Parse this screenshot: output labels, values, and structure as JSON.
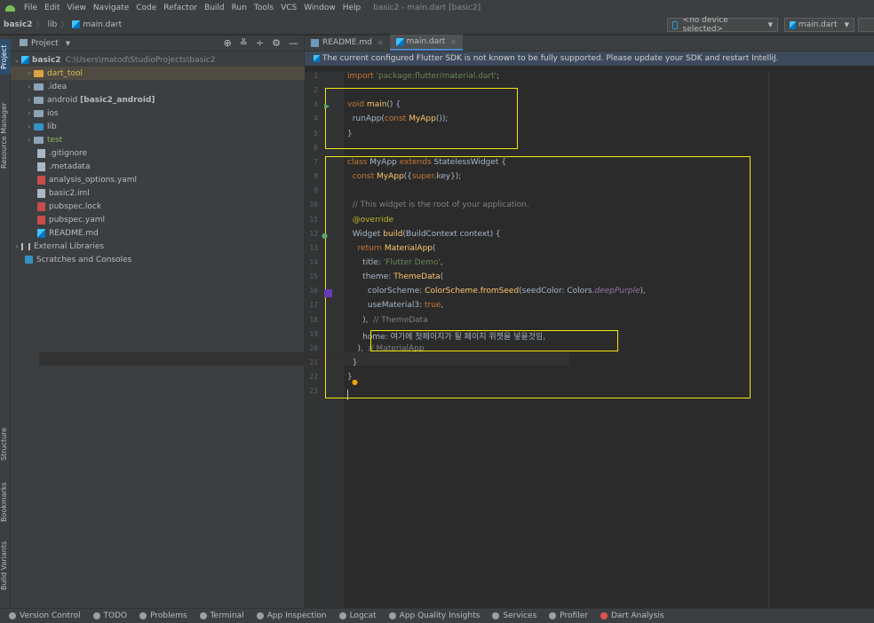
{
  "menu": {
    "items": [
      "File",
      "Edit",
      "View",
      "Navigate",
      "Code",
      "Refactor",
      "Build",
      "Run",
      "Tools",
      "VCS",
      "Window",
      "Help"
    ],
    "window_title": "basic2 - main.dart [basic2]"
  },
  "nav": {
    "crumbs": [
      "basic2",
      "lib",
      "main.dart"
    ],
    "device": "<no device selected>",
    "run_config": "main.dart"
  },
  "side_tabs": {
    "project": "Project",
    "resource_manager": "Resource Manager",
    "structure": "Structure",
    "bookmarks": "Bookmarks",
    "build_variants": "Build Variants"
  },
  "project": {
    "title": "Project",
    "root_name": "basic2",
    "root_path": "C:\\Users\\matod\\StudioProjects\\basic2",
    "items": [
      {
        "label": "dart_tool",
        "kind": "folder-y",
        "depth": 1,
        "expand": true
      },
      {
        "label": ".idea",
        "kind": "folder-g",
        "depth": 1,
        "expand": true
      },
      {
        "label": "android",
        "extra": "[basic2_android]",
        "kind": "folder-g",
        "depth": 1,
        "expand": true
      },
      {
        "label": "ios",
        "kind": "folder-g",
        "depth": 1,
        "expand": true
      },
      {
        "label": "lib",
        "kind": "folder-b",
        "depth": 1,
        "expand": true
      },
      {
        "label": "test",
        "kind": "folder-g",
        "depth": 1,
        "expand": true
      },
      {
        "label": ".gitignore",
        "kind": "file",
        "depth": 1
      },
      {
        "label": ".metadata",
        "kind": "file",
        "depth": 1
      },
      {
        "label": "analysis_options.yaml",
        "kind": "file-yml",
        "depth": 1
      },
      {
        "label": "basic2.iml",
        "kind": "file",
        "depth": 1
      },
      {
        "label": "pubspec.lock",
        "kind": "file-yml",
        "depth": 1
      },
      {
        "label": "pubspec.yaml",
        "kind": "file-yml",
        "depth": 1
      },
      {
        "label": "README.md",
        "kind": "file-md",
        "depth": 1
      },
      {
        "label": "External Libraries",
        "kind": "lib",
        "depth": 0,
        "expand": true
      },
      {
        "label": "Scratches and Consoles",
        "kind": "scratch",
        "depth": 0
      }
    ]
  },
  "tabs": [
    {
      "label": "README.md"
    },
    {
      "label": "main.dart",
      "active": true
    }
  ],
  "banner": "The current configured Flutter SDK is not known to be fully supported. Please update your SDK and restart IntelliJ.",
  "editor": {
    "line_numbers": [
      "1",
      "2",
      "3",
      "4",
      "5",
      "6",
      "7",
      "8",
      "9",
      "10",
      "11",
      "12",
      "13",
      "14",
      "15",
      "16",
      "17",
      "18",
      "19",
      "20",
      "21",
      "22",
      "23"
    ],
    "code": {
      "l1a": "import ",
      "l1b": "'package:flutter/material.dart'",
      "l1c": ";",
      "l3a": "void ",
      "l3b": "main",
      "l3c": "() {",
      "l4a": "  runApp(",
      "l4b": "const ",
      "l4c": "MyApp",
      "l4d": "());",
      "l5a": "}",
      "l7a": "class ",
      "l7b": "MyApp ",
      "l7c": "extends ",
      "l7d": "StatelessWidget {",
      "l8a": "  ",
      "l8b": "const ",
      "l8c": "MyApp",
      "l8d": "({",
      "l8e": "super",
      "l8f": ".key});",
      "l10a": "  // This widget is the root of your application.",
      "l11a": "  @override",
      "l12a": "  Widget ",
      "l12b": "build",
      "l12c": "(BuildContext context) {",
      "l13a": "    ",
      "l13b": "return ",
      "l13c": "MaterialApp",
      "l13d": "(",
      "l14a": "      title: ",
      "l14b": "'Flutter Demo'",
      "l14c": ",",
      "l15a": "      theme: ",
      "l15b": "ThemeData",
      "l15c": "(",
      "l16a": "        colorScheme: ",
      "l16b": "ColorScheme.fromSeed",
      "l16c": "(seedColor: Colors.",
      "l16d": "deepPurple",
      "l16e": "),",
      "l17a": "        useMaterial3: ",
      "l17b": "true",
      "l17c": ",",
      "l18a": "      ),  ",
      "l18b": "// ThemeData",
      "l19a": "      home: 여기에 첫페이지가 될 페이지 위젯을 넣을것임,",
      "l20a": "    ),  ",
      "l20b": "// MaterialApp",
      "l21a": "  }",
      "l22a": "}"
    }
  },
  "statusbar": [
    "Version Control",
    "TODO",
    "Problems",
    "Terminal",
    "App Inspection",
    "Logcat",
    "App Quality Insights",
    "Services",
    "Profiler",
    "Dart Analysis"
  ],
  "colors": {
    "highlight": "#f5e70a",
    "keyword": "#cc7832",
    "string": "#6a8759",
    "function": "#ffc66d",
    "comment": "#808080"
  }
}
